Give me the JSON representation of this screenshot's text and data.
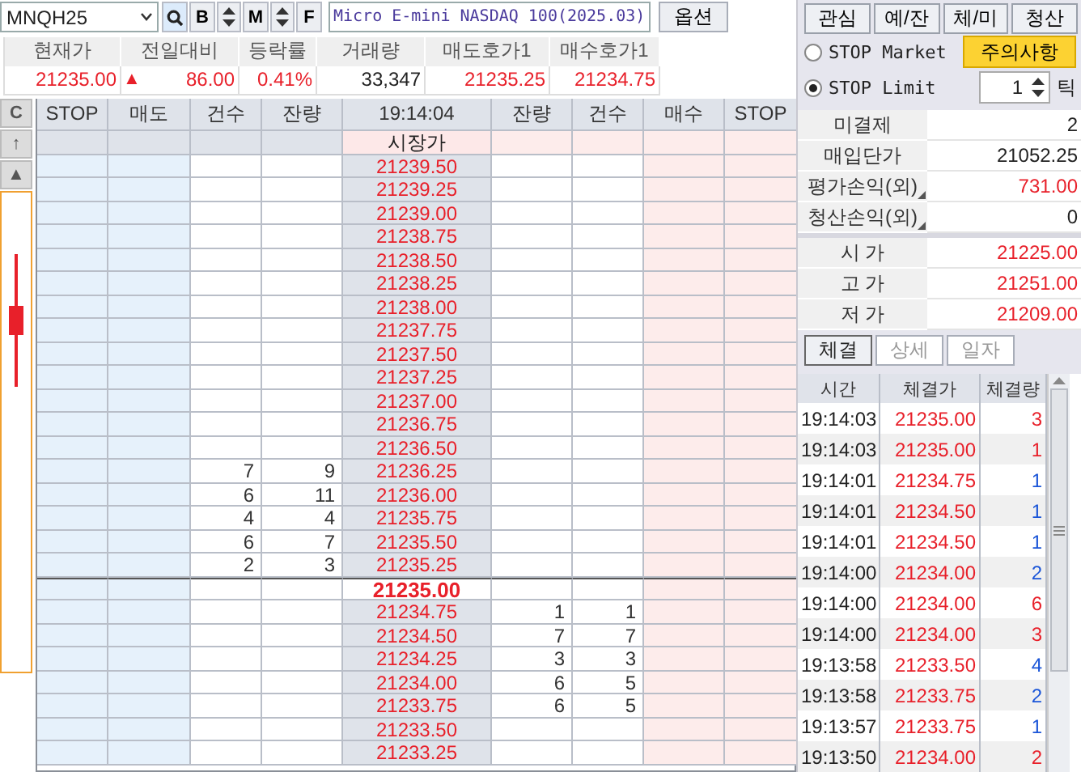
{
  "symbol": {
    "value": "MNQH25"
  },
  "toolbar": [
    {
      "kind": "search"
    },
    {
      "kind": "letter",
      "label": "B"
    },
    {
      "kind": "stepper"
    },
    {
      "kind": "letter",
      "label": "M"
    },
    {
      "kind": "stepper"
    },
    {
      "kind": "letter",
      "label": "F"
    }
  ],
  "instrument_name": "Micro E-mini NASDAQ 100(2025.03)",
  "option_button": "옵션",
  "quote": {
    "columns": [
      "현재가",
      "전일대비",
      "등락률",
      "거래량",
      "매도호가1",
      "매수호가1"
    ],
    "values": [
      {
        "text": "21235.00",
        "color": "#e8202a"
      },
      {
        "text": "86.00",
        "color": "#e8202a",
        "sign": "▲"
      },
      {
        "text": "0.41%",
        "color": "#e8202a"
      },
      {
        "text": "33,347",
        "color": "#222222"
      },
      {
        "text": "21235.25",
        "color": "#e8202a"
      },
      {
        "text": "21234.75",
        "color": "#e8202a"
      }
    ]
  },
  "orderbook": {
    "side_buttons": [
      "C",
      "↑",
      "▲"
    ],
    "columns": [
      "STOP",
      "매도",
      "건수",
      "잔량",
      "19:14:04",
      "잔량",
      "건수",
      "매수",
      "STOP"
    ],
    "market_label": "시장가",
    "rows": [
      {
        "price": "21239.50",
        "current": false
      },
      {
        "price": "21239.25",
        "current": false
      },
      {
        "price": "21239.00",
        "current": false
      },
      {
        "price": "21238.75",
        "current": false
      },
      {
        "price": "21238.50",
        "current": false
      },
      {
        "price": "21238.25",
        "current": false
      },
      {
        "price": "21238.00",
        "current": false
      },
      {
        "price": "21237.75",
        "current": false
      },
      {
        "price": "21237.50",
        "current": false
      },
      {
        "price": "21237.25",
        "current": false
      },
      {
        "price": "21237.00",
        "current": false
      },
      {
        "price": "21236.75",
        "current": false
      },
      {
        "price": "21236.50",
        "current": false
      },
      {
        "price": "21236.25",
        "current": false,
        "ask_count": "7",
        "ask_qty": "9"
      },
      {
        "price": "21236.00",
        "current": false,
        "ask_count": "6",
        "ask_qty": "11"
      },
      {
        "price": "21235.75",
        "current": false,
        "ask_count": "4",
        "ask_qty": "4"
      },
      {
        "price": "21235.50",
        "current": false,
        "ask_count": "6",
        "ask_qty": "7"
      },
      {
        "price": "21235.25",
        "current": false,
        "ask_count": "2",
        "ask_qty": "3"
      },
      {
        "price": "21235.00",
        "current": true
      },
      {
        "price": "21234.75",
        "current": false,
        "bid_qty": "1",
        "bid_count": "1"
      },
      {
        "price": "21234.50",
        "current": false,
        "bid_qty": "7",
        "bid_count": "7"
      },
      {
        "price": "21234.25",
        "current": false,
        "bid_qty": "3",
        "bid_count": "3"
      },
      {
        "price": "21234.00",
        "current": false,
        "bid_qty": "6",
        "bid_count": "5"
      },
      {
        "price": "21233.75",
        "current": false,
        "bid_qty": "6",
        "bid_count": "5"
      },
      {
        "price": "21233.50",
        "current": false
      },
      {
        "price": "21233.25",
        "current": false
      }
    ]
  },
  "side_panel": {
    "tabs": [
      "관심",
      "예/잔",
      "체/미",
      "청산"
    ],
    "order_types": [
      {
        "label": "STOP Market",
        "selected": false
      },
      {
        "label": "STOP Limit",
        "selected": true
      }
    ],
    "notice_button": "주의사항",
    "tick": {
      "value": "1",
      "unit": "틱"
    },
    "position": [
      {
        "label": "미결제",
        "value": "2",
        "color": "#222222",
        "corner_mark": false
      },
      {
        "label": "매입단가",
        "value": "21052.25",
        "color": "#222222",
        "corner_mark": false
      },
      {
        "label": "평가손익(외)",
        "value": "731.00",
        "color": "#e8202a",
        "corner_mark": true
      },
      {
        "label": "청산손익(외)",
        "value": "0",
        "color": "#222222",
        "corner_mark": true
      }
    ],
    "prices": [
      {
        "label": "시 가",
        "value": "21225.00"
      },
      {
        "label": "고 가",
        "value": "21251.00"
      },
      {
        "label": "저 가",
        "value": "21209.00"
      }
    ],
    "detail_tabs": [
      {
        "label": "체결",
        "selected": true
      },
      {
        "label": "상세",
        "selected": false
      },
      {
        "label": "일자",
        "selected": false
      }
    ],
    "trades": {
      "columns": [
        "시간",
        "체결가",
        "체결량"
      ],
      "rows": [
        {
          "time": "19:14:03",
          "price": "21235.00",
          "qty": "3",
          "color": "#e8202a"
        },
        {
          "time": "19:14:03",
          "price": "21235.00",
          "qty": "1",
          "color": "#e8202a"
        },
        {
          "time": "19:14:01",
          "price": "21234.75",
          "qty": "1",
          "color": "#1a55d8"
        },
        {
          "time": "19:14:01",
          "price": "21234.50",
          "qty": "1",
          "color": "#1a55d8"
        },
        {
          "time": "19:14:01",
          "price": "21234.50",
          "qty": "1",
          "color": "#1a55d8"
        },
        {
          "time": "19:14:00",
          "price": "21234.00",
          "qty": "2",
          "color": "#1a55d8"
        },
        {
          "time": "19:14:00",
          "price": "21234.00",
          "qty": "6",
          "color": "#e8202a"
        },
        {
          "time": "19:14:00",
          "price": "21234.00",
          "qty": "3",
          "color": "#e8202a"
        },
        {
          "time": "19:13:58",
          "price": "21233.50",
          "qty": "4",
          "color": "#1a55d8"
        },
        {
          "time": "19:13:58",
          "price": "21233.75",
          "qty": "2",
          "color": "#1a55d8"
        },
        {
          "time": "19:13:57",
          "price": "21233.75",
          "qty": "1",
          "color": "#1a55d8"
        },
        {
          "time": "19:13:50",
          "price": "21234.00",
          "qty": "2",
          "color": "#e8202a"
        }
      ]
    }
  }
}
